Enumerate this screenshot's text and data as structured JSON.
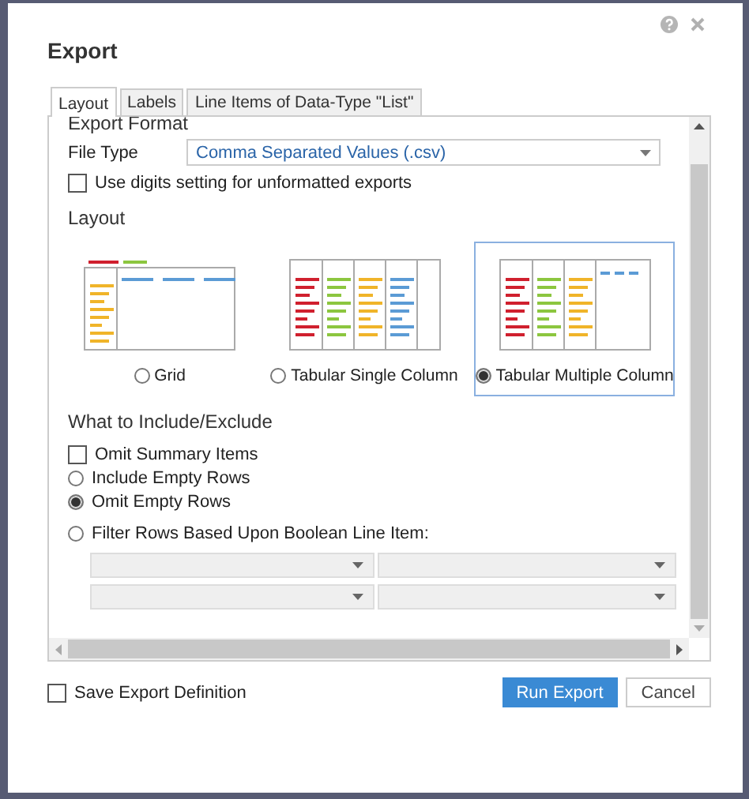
{
  "dialog": {
    "title": "Export"
  },
  "tabs": [
    {
      "label": "Layout",
      "selected": true
    },
    {
      "label": "Labels",
      "selected": false
    },
    {
      "label": "Line Items of Data-Type \"List\"",
      "selected": false
    }
  ],
  "export_format": {
    "heading": "Export Format",
    "file_type_label": "File Type",
    "file_type_value": "Comma Separated Values (.csv)",
    "digits_label": "Use digits setting for unformatted exports",
    "digits_checked": false
  },
  "layout": {
    "heading": "Layout",
    "options": [
      {
        "kind": "grid",
        "label": "Grid",
        "selected": false
      },
      {
        "kind": "single",
        "label": "Tabular Single Column",
        "selected": false
      },
      {
        "kind": "multiple",
        "label": "Tabular Multiple Column",
        "selected": true
      }
    ]
  },
  "include": {
    "heading": "What to Include/Exclude",
    "items": [
      {
        "kind": "checkbox",
        "label": "Omit Summary Items",
        "checked": false
      },
      {
        "kind": "radio",
        "label": "Include Empty Rows",
        "checked": false
      },
      {
        "kind": "radio",
        "label": "Omit Empty Rows",
        "checked": true
      },
      {
        "kind": "radio",
        "label": "Filter Rows Based Upon Boolean Line Item:",
        "checked": false
      }
    ],
    "filter_dropdowns": [
      {
        "disabled": true
      },
      {
        "disabled": true
      },
      {
        "disabled": true
      },
      {
        "disabled": true
      }
    ]
  },
  "footer": {
    "save_label": "Save Export Definition",
    "save_checked": false,
    "buttons": [
      {
        "label": "Run Export",
        "kind": "primary"
      },
      {
        "label": "Cancel",
        "kind": "secondary"
      }
    ]
  }
}
